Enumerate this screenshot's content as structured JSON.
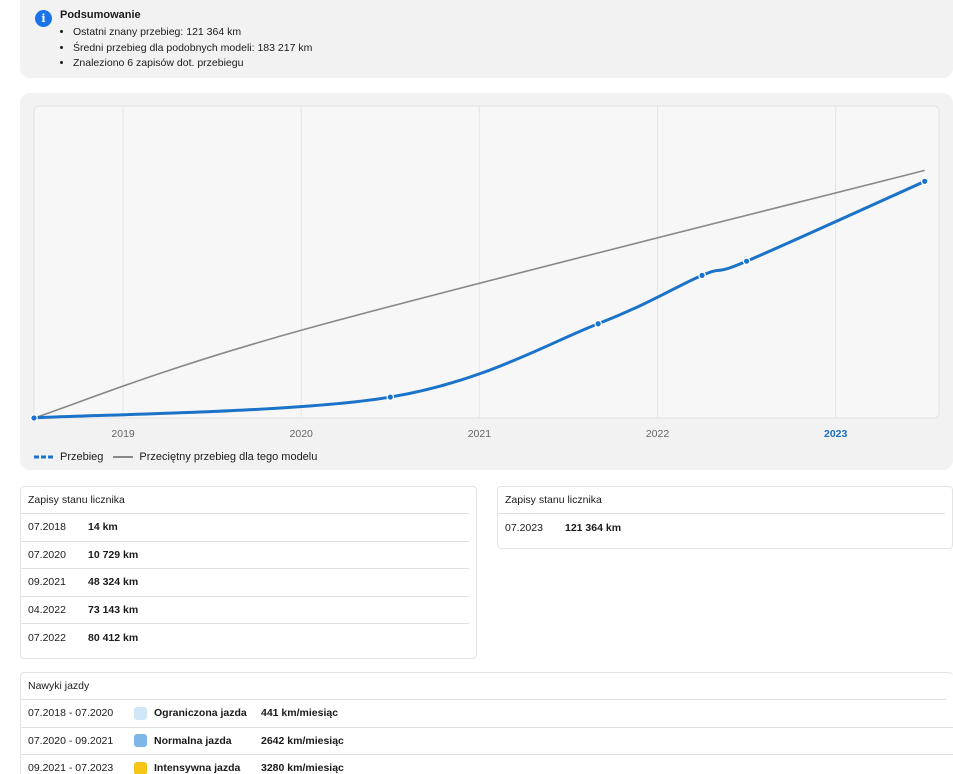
{
  "summary": {
    "title": "Podsumowanie",
    "items": [
      "Ostatni znany przebieg: 121 364 km",
      "Średni przebieg dla podobnych modeli: 183 217 km",
      "Znaleziono 6 zapisów dot. przebiegu"
    ]
  },
  "chart_data": {
    "type": "line",
    "x_ticks": [
      "2019",
      "2020",
      "2021",
      "2022",
      "2023"
    ],
    "highlighted_tick": "2023",
    "series": [
      {
        "name": "Przebieg",
        "color": "#1a73c8",
        "style": "dashed-dotted",
        "points": [
          {
            "date": "07.2018",
            "km": 14
          },
          {
            "date": "07.2020",
            "km": 10729
          },
          {
            "date": "09.2021",
            "km": 48324
          },
          {
            "date": "04.2022",
            "km": 73143
          },
          {
            "date": "07.2022",
            "km": 80412
          },
          {
            "date": "07.2023",
            "km": 121364
          }
        ]
      },
      {
        "name": "Przeciętny przebieg dla tego modelu",
        "color": "#888888",
        "style": "solid",
        "points": [
          {
            "date": "07.2018",
            "km": 0
          },
          {
            "date": "01.2020",
            "km": 45000
          },
          {
            "date": "07.2023",
            "km": 127000
          }
        ]
      }
    ],
    "grid": true,
    "legend_position": "bottom-left"
  },
  "records_left": {
    "title": "Zapisy stanu licznika",
    "rows": [
      {
        "date": "07.2018",
        "km": "14 km"
      },
      {
        "date": "07.2020",
        "km": "10 729 km"
      },
      {
        "date": "09.2021",
        "km": "48 324 km"
      },
      {
        "date": "04.2022",
        "km": "73 143 km"
      },
      {
        "date": "07.2022",
        "km": "80 412 km"
      }
    ]
  },
  "records_right": {
    "title": "Zapisy stanu licznika",
    "rows": [
      {
        "date": "07.2023",
        "km": "121 364 km"
      }
    ]
  },
  "habits": {
    "title": "Nawyki jazdy",
    "rows": [
      {
        "period": "07.2018 - 07.2020",
        "label": "Ograniczona jazda",
        "rate": "441 km/miesiąc",
        "color": "#cfe6f7"
      },
      {
        "period": "07.2020 - 09.2021",
        "label": "Normalna jazda",
        "rate": "2642 km/miesiąc",
        "color": "#7fb6ea"
      },
      {
        "period": "09.2021 - 07.2023",
        "label": "Intensywna jazda",
        "rate": "3280 km/miesiąc",
        "color": "#f5c518"
      }
    ]
  }
}
